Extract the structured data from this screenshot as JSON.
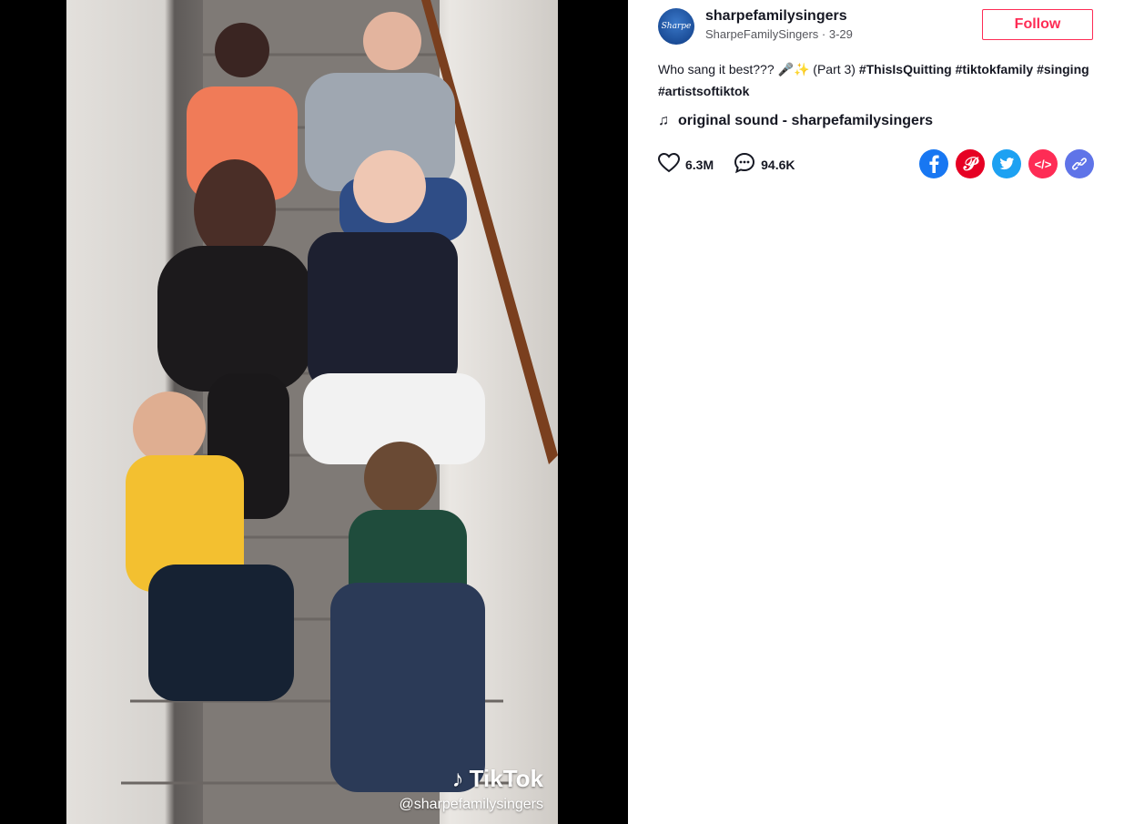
{
  "video": {
    "watermark_brand": "TikTok",
    "watermark_handle": "@sharpefamilysingers"
  },
  "author": {
    "username": "sharpefamilysingers",
    "display_name": "SharpeFamilySingers",
    "date": "3-29",
    "separator": " · ",
    "avatar_text": "Sharpe"
  },
  "follow_label": "Follow",
  "description": {
    "text": "Who sang it best??? 🎤✨ (Part 3)",
    "hashtags": [
      "#ThisIsQuitting",
      "#tiktokfamily",
      "#singing",
      "#artistsoftiktok"
    ]
  },
  "sound": "original sound - sharpefamilysingers",
  "stats": {
    "likes": "6.3M",
    "comments": "94.6K"
  },
  "share_icons": [
    "facebook-icon",
    "pinterest-icon",
    "twitter-icon",
    "embed-icon",
    "copy-link-icon"
  ],
  "colors": {
    "accent": "#fe2c55",
    "facebook": "#1877f2",
    "pinterest": "#e60023",
    "twitter": "#1da1f2",
    "embed": "#fe2c55",
    "link": "#5f74e8"
  }
}
